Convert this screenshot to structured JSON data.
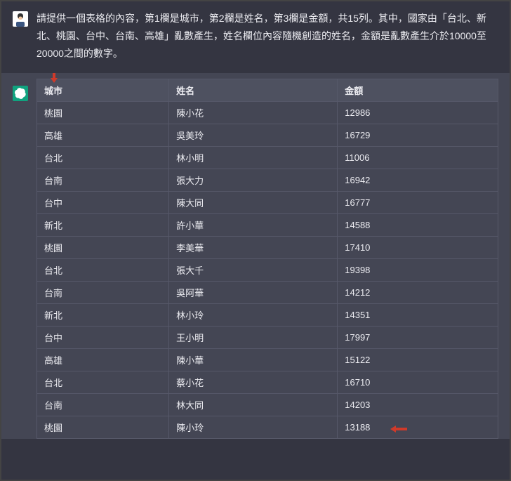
{
  "user_message": "請提供一個表格的內容，第1欄是城市，第2欄是姓名，第3欄是金額，共15列。其中，國家由「台北、新北、桃園、台中、台南、高雄」亂數產生，姓名欄位內容隨機創造的姓名，金額是亂數產生介於10000至20000之間的數字。",
  "table": {
    "headers": [
      "城市",
      "姓名",
      "金額"
    ],
    "rows": [
      [
        "桃園",
        "陳小花",
        "12986"
      ],
      [
        "高雄",
        "吳美玲",
        "16729"
      ],
      [
        "台北",
        "林小明",
        "11006"
      ],
      [
        "台南",
        "張大力",
        "16942"
      ],
      [
        "台中",
        "陳大同",
        "16777"
      ],
      [
        "新北",
        "許小華",
        "14588"
      ],
      [
        "桃園",
        "李美華",
        "17410"
      ],
      [
        "台北",
        "張大千",
        "19398"
      ],
      [
        "台南",
        "吳阿華",
        "14212"
      ],
      [
        "新北",
        "林小玲",
        "14351"
      ],
      [
        "台中",
        "王小明",
        "17997"
      ],
      [
        "高雄",
        "陳小華",
        "15122"
      ],
      [
        "台北",
        "蔡小花",
        "16710"
      ],
      [
        "台南",
        "林大同",
        "14203"
      ],
      [
        "桃園",
        "陳小玲",
        "13188"
      ]
    ]
  }
}
